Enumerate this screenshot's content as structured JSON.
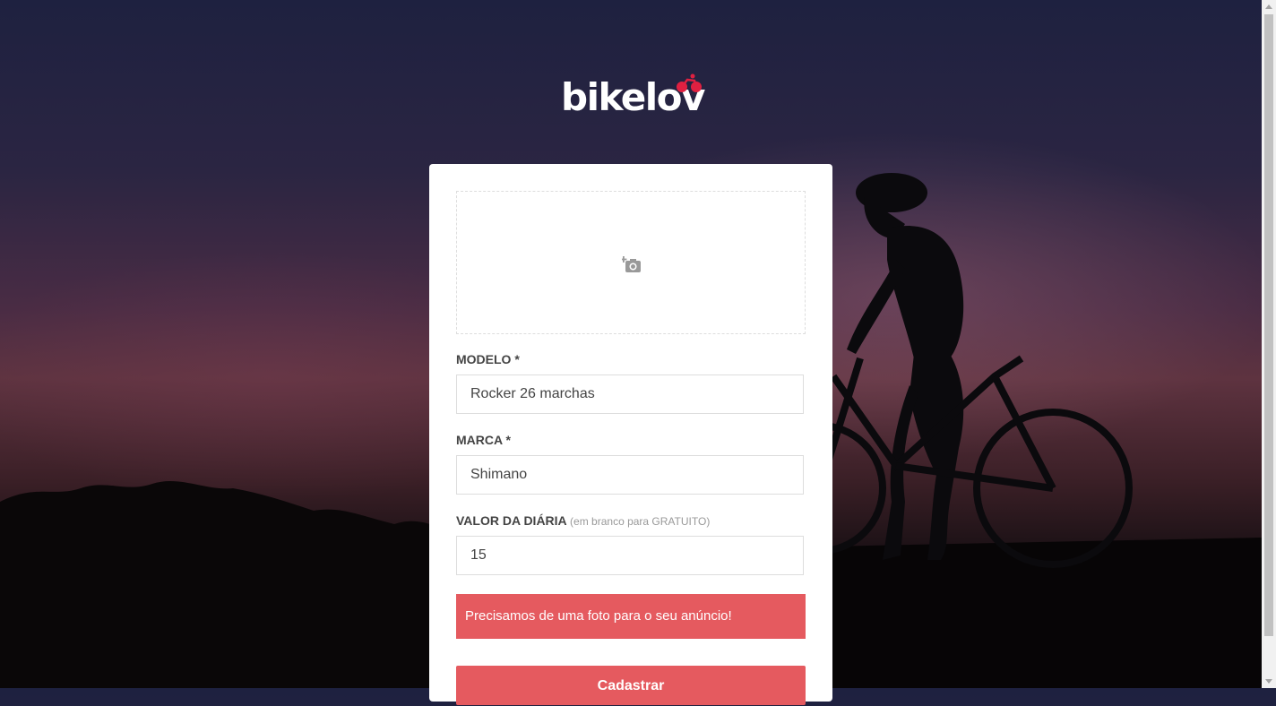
{
  "brand": {
    "name": "bikelov",
    "accent": "#e02041"
  },
  "upload": {
    "icon": "add-photo-icon"
  },
  "form": {
    "modelo": {
      "label": "MODELO *",
      "value": "Rocker 26 marchas"
    },
    "marca": {
      "label": "MARCA *",
      "value": "Shimano"
    },
    "valor": {
      "label": "VALOR DA DIÁRIA",
      "hint": "(em branco para GRATUITO)",
      "value": "15"
    }
  },
  "error_message": "Precisamos de uma foto para o seu anúncio!",
  "submit_label": "Cadastrar",
  "colors": {
    "button": "#e55a5f",
    "error_bg": "#e55a5f"
  }
}
